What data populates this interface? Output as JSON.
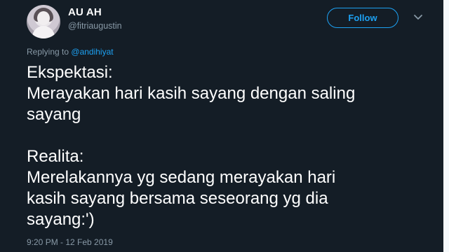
{
  "user": {
    "display_name": "AU AH",
    "handle": "@fitriaugustin",
    "avatar_icon": "profile-photo"
  },
  "actions": {
    "follow_label": "Follow",
    "more_icon": "chevron-down-icon"
  },
  "reply": {
    "prefix": "Replying to",
    "mention": "@andihiyat"
  },
  "tweet": {
    "lines": [
      "Ekspektasi:",
      "Merayakan hari kasih sayang dengan saling",
      "sayang",
      "",
      "Realita:",
      "Merelakannya yg sedang merayakan hari",
      "kasih sayang bersama seseorang yg dia",
      "sayang:')"
    ],
    "timestamp": "9:20 PM - 12 Feb 2019"
  },
  "colors": {
    "background": "#141d26",
    "accent": "#1da1f2",
    "secondary_text": "#8899a6",
    "primary_text": "#ffffff"
  }
}
